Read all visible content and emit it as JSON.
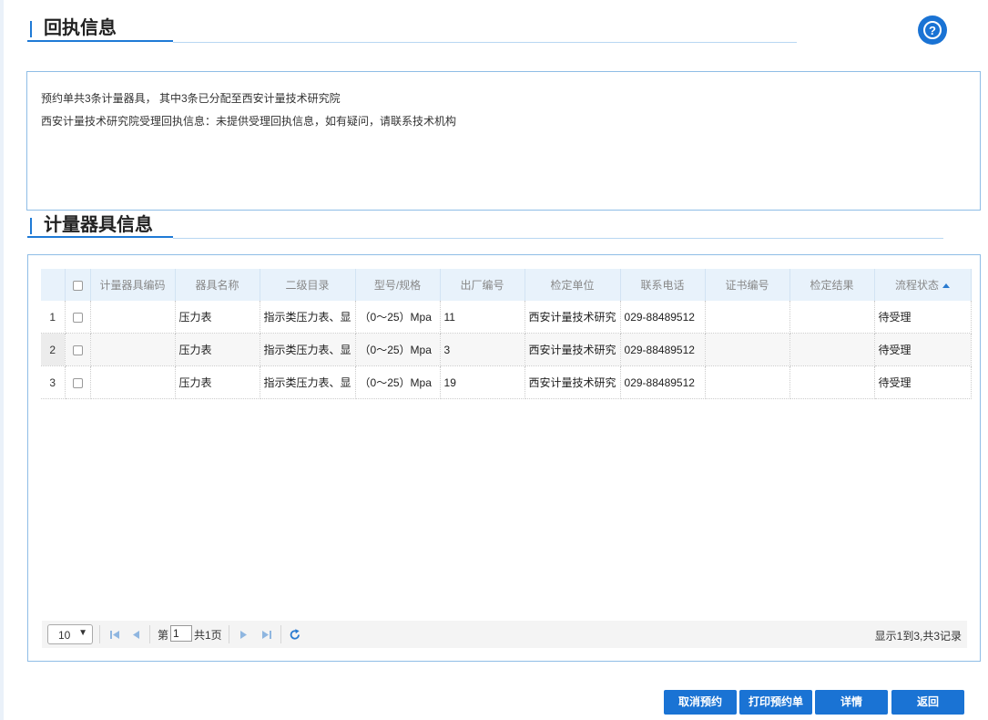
{
  "receipt": {
    "title": "回执信息",
    "lines": [
      "预约单共3条计量器具， 其中3条已分配至西安计量技术研究院",
      "西安计量技术研究院受理回执信息：未提供受理回执信息，如有疑问，请联系技术机构"
    ]
  },
  "instruments": {
    "title": "计量器具信息",
    "columns": [
      "计量器具编码",
      "器具名称",
      "二级目录",
      "型号/规格",
      "出厂编号",
      "检定单位",
      "联系电话",
      "证书编号",
      "检定结果",
      "流程状态"
    ],
    "rows": [
      {
        "index": "1",
        "code": "",
        "name": "压力表",
        "category": "指示类压力表、显",
        "model": "（0～25）Mpa",
        "serial": "11",
        "unit": "西安计量技术研究",
        "phone": "029-88489512",
        "cert": "",
        "result": "",
        "status": "待受理"
      },
      {
        "index": "2",
        "code": "",
        "name": "压力表",
        "category": "指示类压力表、显",
        "model": "（0～25）Mpa",
        "serial": "3",
        "unit": "西安计量技术研究",
        "phone": "029-88489512",
        "cert": "",
        "result": "",
        "status": "待受理"
      },
      {
        "index": "3",
        "code": "",
        "name": "压力表",
        "category": "指示类压力表、显",
        "model": "（0～25）Mpa",
        "serial": "19",
        "unit": "西安计量技术研究",
        "phone": "029-88489512",
        "cert": "",
        "result": "",
        "status": "待受理"
      }
    ]
  },
  "pager": {
    "page_size": "10",
    "page_prefix": "第",
    "page_value": "1",
    "page_suffix": "共1页",
    "summary": "显示1到3,共3记录"
  },
  "buttons": {
    "cancel": "取消预约",
    "print": "打印预约单",
    "detail": "详情",
    "back": "返回"
  },
  "colors": {
    "accent": "#1a73d4",
    "header_bg": "#e8f2fb",
    "border": "#8fbde6"
  },
  "icons": {
    "help": "help-icon",
    "first": "first-page-icon",
    "prev": "prev-page-icon",
    "next": "next-page-icon",
    "last": "last-page-icon",
    "refresh": "refresh-icon"
  }
}
